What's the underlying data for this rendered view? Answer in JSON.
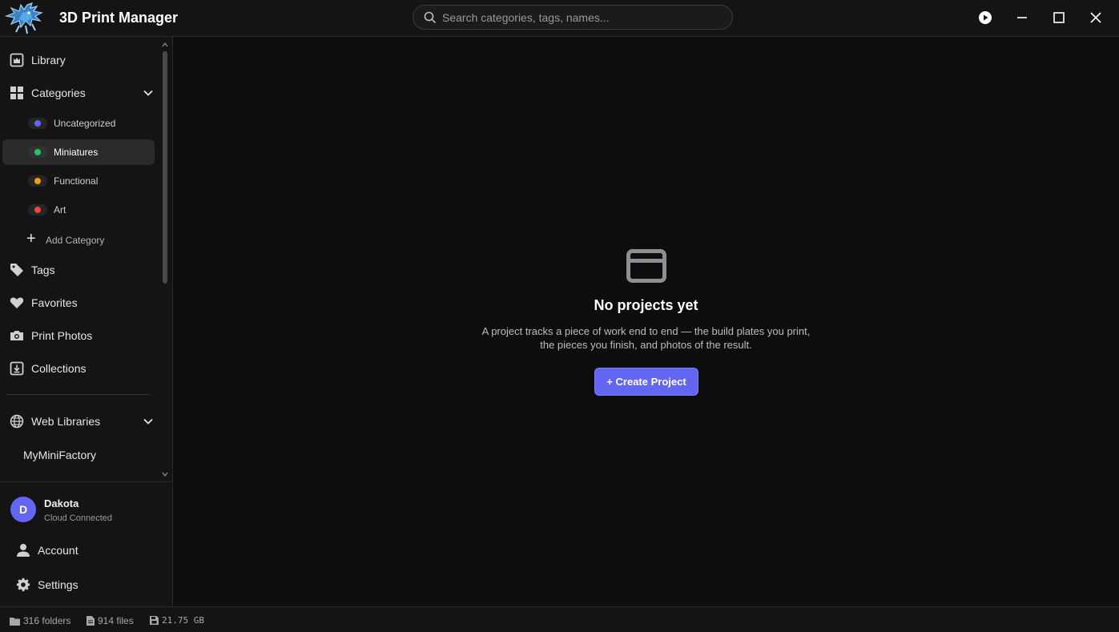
{
  "app": {
    "title": "3D Print Manager",
    "accent_color": "#6366f1"
  },
  "search": {
    "placeholder": "Search categories, tags, names..."
  },
  "window_controls": [
    "play-icon",
    "minimize-icon",
    "maximize-icon",
    "close-icon"
  ],
  "sidebar": {
    "library_label": "Library",
    "categories_label": "Categories",
    "categories": [
      {
        "label": "Uncategorized",
        "color": "#6366f1"
      },
      {
        "label": "Miniatures",
        "color": "#22c55e"
      },
      {
        "label": "Functional",
        "color": "#f59e0b"
      },
      {
        "label": "Art",
        "color": "#ef4444"
      }
    ],
    "active_category": "Miniatures",
    "add_category_label": "Add Category",
    "tags_label": "Tags",
    "favorites_label": "Favorites",
    "print_photos_label": "Print Photos",
    "collections_label": "Collections",
    "web_libraries_label": "Web Libraries",
    "web_libraries": [
      {
        "label": "MyMiniFactory"
      }
    ]
  },
  "user": {
    "initial": "D",
    "name": "Dakota",
    "status": "Cloud Connected",
    "account_label": "Account",
    "settings_label": "Settings"
  },
  "empty_state": {
    "title": "No projects yet",
    "description_line1": "A project tracks a piece of work end to end — the build plates you print,",
    "description_line2": "the pieces you finish, and photos of the result.",
    "button_label": "+ Create Project"
  },
  "status_bar": {
    "folders_count": "316",
    "folders_label": "folders",
    "files_count": "914",
    "files_label": "files",
    "size": "21.75 GB"
  }
}
